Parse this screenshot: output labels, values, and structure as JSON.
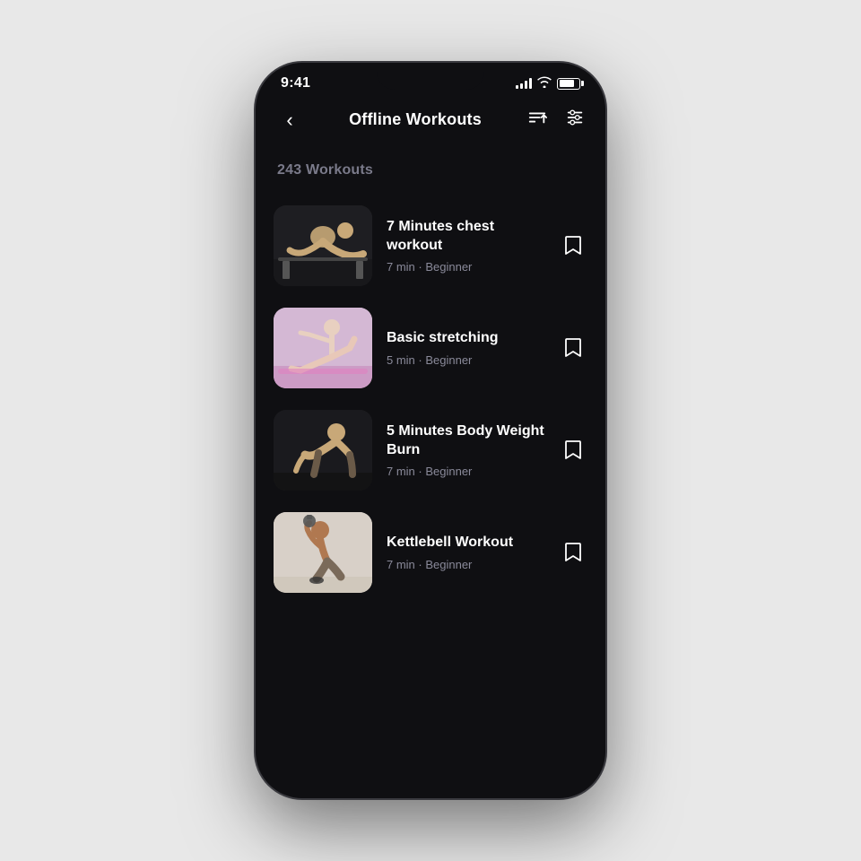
{
  "statusBar": {
    "time": "9:41",
    "batteryLevel": 80
  },
  "header": {
    "backLabel": "‹",
    "title": "Offline Workouts",
    "sortIconName": "sort-icon",
    "filterIconName": "filter-icon"
  },
  "workoutsCount": "243 Workouts",
  "workouts": [
    {
      "id": 1,
      "name": "7 Minutes chest workout",
      "duration": "7 min",
      "level": "Beginner",
      "meta": "7 min · Beginner",
      "thumbStyle": "dark-gym",
      "bookmarked": false
    },
    {
      "id": 2,
      "name": "Basic stretching",
      "duration": "5 min",
      "level": "Beginner",
      "meta": "5 min · Beginner",
      "thumbStyle": "light-stretch",
      "bookmarked": false
    },
    {
      "id": 3,
      "name": "5 Minutes Body Weight Burn",
      "duration": "7 min",
      "level": "Beginner",
      "meta": "7 min · Beginner",
      "thumbStyle": "dark-bodyweight",
      "bookmarked": false
    },
    {
      "id": 4,
      "name": "Kettlebell Workout",
      "duration": "7 min",
      "level": "Beginner",
      "meta": "7 min · Beginner",
      "thumbStyle": "light-kettlebell",
      "bookmarked": false
    }
  ]
}
